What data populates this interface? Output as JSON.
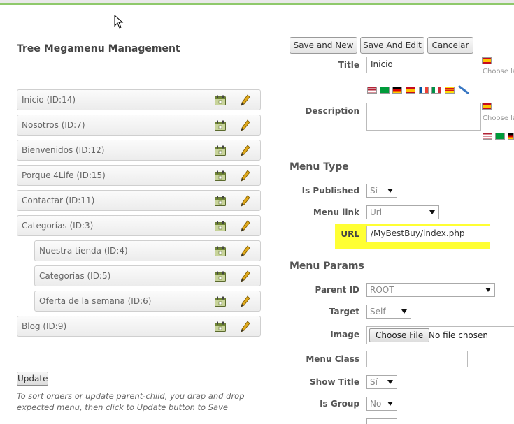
{
  "left": {
    "title": "Tree Megamenu Management",
    "items": [
      {
        "label": "Inicio (ID:14)",
        "level": 0
      },
      {
        "label": "Nosotros (ID:7)",
        "level": 0
      },
      {
        "label": "Bienvenidos (ID:12)",
        "level": 0
      },
      {
        "label": "Porque 4Life (ID:15)",
        "level": 0
      },
      {
        "label": "Contactar (ID:11)",
        "level": 0
      },
      {
        "label": "Categorías (ID:3)",
        "level": 0
      },
      {
        "label": "Nuestra tienda (ID:4)",
        "level": 1
      },
      {
        "label": "Categorías (ID:5)",
        "level": 1
      },
      {
        "label": "Oferta de la semana (ID:6)",
        "level": 1
      },
      {
        "label": "Blog (ID:9)",
        "level": 0
      }
    ],
    "update_label": "Update",
    "hint": "To sort orders or update parent-child, you drap and drop expected menu, then click to Update button to Save"
  },
  "toolbar": {
    "save_new": "Save and New",
    "save_edit": "Save And Edit",
    "cancel": "Cancelar"
  },
  "form": {
    "title_label": "Title",
    "title_value": "Inicio",
    "choose_lang": "Choose la",
    "description_label": "Description",
    "menu_type_heading": "Menu Type",
    "is_published_label": "Is Published",
    "is_published_value": "Sí",
    "menu_link_label": "Menu link",
    "menu_link_value": "Url",
    "url_label": "URL",
    "url_value": "/MyBestBuy/index.php",
    "menu_params_heading": "Menu Params",
    "parent_id_label": "Parent ID",
    "parent_id_value": "ROOT",
    "target_label": "Target",
    "target_value": "Self",
    "image_label": "Image",
    "choose_file": "Choose File",
    "no_file": "No file chosen",
    "menu_class_label": "Menu Class",
    "show_title_label": "Show Title",
    "show_title_value": "Sí",
    "is_group_label": "Is Group",
    "is_group_value": "No"
  },
  "colors": {
    "highlight": "#ffff33",
    "accent_green": "#8fc96b"
  }
}
